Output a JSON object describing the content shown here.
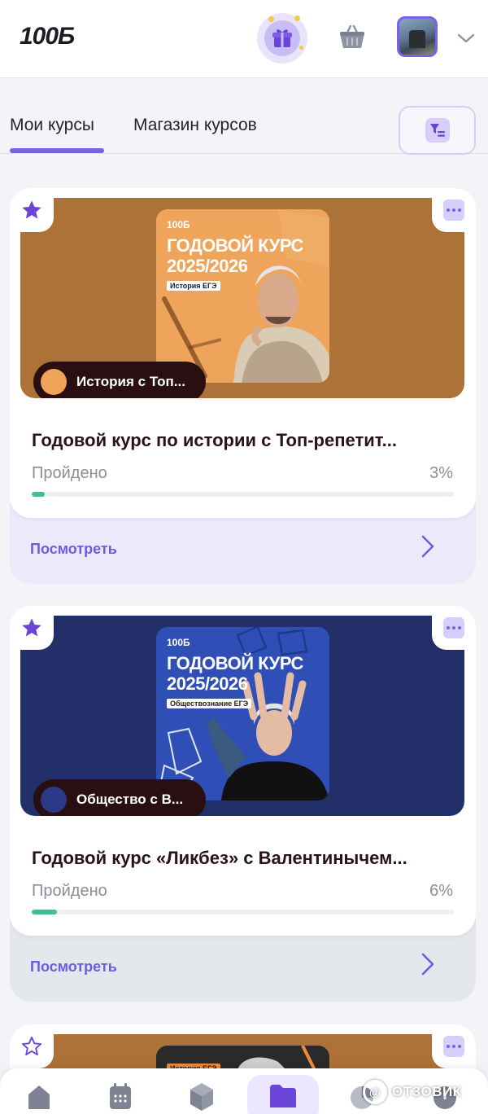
{
  "header": {
    "logo": "100Б",
    "icons": [
      "gift-icon",
      "basket-icon",
      "avatar",
      "chevron-down-icon"
    ]
  },
  "tabs": {
    "my_courses": "Мои курсы",
    "shop": "Магазин курсов",
    "active": "my_courses",
    "filter_icon": "filter-icon"
  },
  "courses": [
    {
      "poster_brand": "100Б",
      "poster_title_line1": "ГОДОВОЙ КУРС",
      "poster_title_line2": "2025/2026",
      "poster_subject": "История ЕГЭ",
      "teacher_chip": "История с Топ...",
      "title": "Годовой курс по истории с Топ-репетит...",
      "progress_label": "Пройдено",
      "progress_percent": "3%",
      "progress_value": 0.03,
      "view_label": "Посмотреть",
      "banner_color": "#ad7238",
      "poster_color": "#eea45a",
      "chip_dot_color": "#f0a45a",
      "bottom_color": "#ece9fb"
    },
    {
      "poster_brand": "100Б",
      "poster_title_line1": "ГОДОВОЙ КУРС",
      "poster_title_line2": "2025/2026",
      "poster_subject": "Обществознание ЕГЭ",
      "teacher_chip": "Общество с В...",
      "title": "Годовой курс «Ликбез» с Валентинычем...",
      "progress_label": "Пройдено",
      "progress_percent": "6%",
      "progress_value": 0.06,
      "view_label": "Посмотреть",
      "banner_color": "#222f68",
      "poster_color": "#2f4fb6",
      "chip_dot_color": "#2a3a88",
      "bottom_color": "#e4e7ec"
    },
    {
      "poster_subject": "История ЕГЭ",
      "banner_color": "#ad7238"
    }
  ],
  "bottom_nav": {
    "items": [
      "home-icon",
      "calendar-icon",
      "cube-icon",
      "folder-icon",
      "chart-icon",
      "info-icon"
    ],
    "active": "folder-icon"
  },
  "watermark": {
    "text": "ОТЗОВИК",
    "badge": "@"
  },
  "colors": {
    "accent": "#7b61e8",
    "progress": "#3ec18d",
    "chip_bg": "#2a0f12",
    "title_text": "#2b1215"
  }
}
